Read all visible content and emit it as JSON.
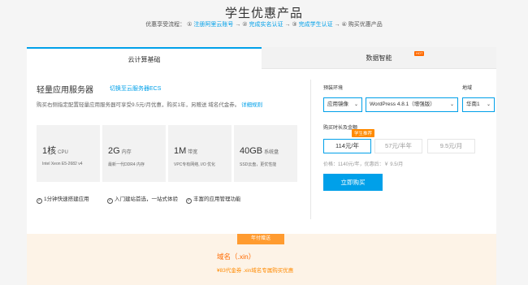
{
  "page": {
    "title": "学生优惠产品",
    "flow": {
      "prefix": "优惠享受流程：",
      "steps": [
        {
          "num": "①",
          "label": "注册阿里云账号",
          "link": true
        },
        {
          "num": "②",
          "label": "完成实名认证",
          "link": true
        },
        {
          "num": "③",
          "label": "完成学生认证",
          "link": true
        },
        {
          "num": "④",
          "label": "购买优惠产品",
          "link": false
        }
      ],
      "arrow": "→"
    }
  },
  "tabs": [
    {
      "label": "云计算基础",
      "active": true
    },
    {
      "label": "数据智能",
      "active": false,
      "badge": "HOT"
    }
  ],
  "product": {
    "title": "轻量应用服务器",
    "switch_link": "切换至云服务器ECS",
    "desc": "购买右侧指定配置轻量应用服务器可享受9.5元/月优惠，购买1年，另赠送 域名代金券。",
    "rules_link": "详细规则",
    "specs": [
      {
        "big": "1核",
        "unit": "CPU",
        "sub": "Intel Xeon E5-2682 v4"
      },
      {
        "big": "2G",
        "unit": "内存",
        "sub": "最新一代DDR4 内存"
      },
      {
        "big": "1M",
        "unit": "带宽",
        "sub": "VPC专有网络, I/O 优化"
      },
      {
        "big": "40GB",
        "unit": "系统盘",
        "sub": "SSD云盘，更优性能"
      }
    ],
    "features": [
      "1分钟快速搭建应用",
      "入门建站首选，一站式体验",
      "丰富的应用管理功能"
    ]
  },
  "config": {
    "env_label": "预装环境",
    "env_type": "应用镜像",
    "env_value": "WordPress 4.8.1（增强版）",
    "region_label": "地域",
    "region_value": "华南1",
    "duration_label": "购买时长及金额",
    "recommend_badge": "学生推荐",
    "durations": [
      "114元/年",
      "57元/半年",
      "9.5元/月"
    ],
    "price_text": "价格：1140元/年，优惠后：￥ 9.5/月",
    "buy_label": "立即购买",
    "arrow": "⌄"
  },
  "bonus": {
    "badge": "年付赠送",
    "title": "域名（.xin）",
    "desc": "¥83代金券 .xin域名专属购买优惠"
  }
}
